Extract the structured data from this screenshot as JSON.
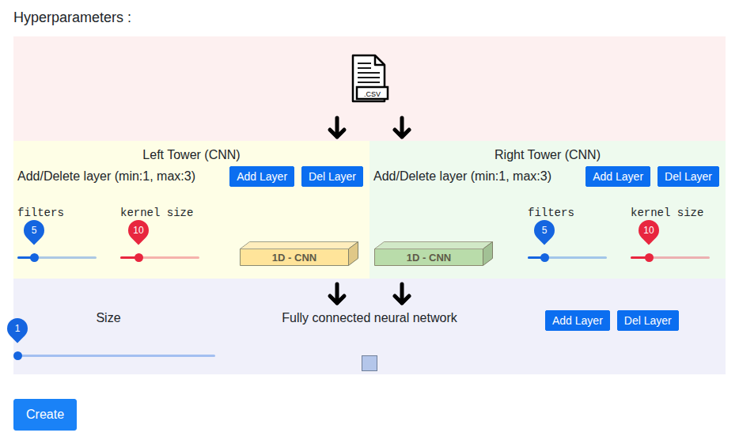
{
  "title": "Hyperparameters :",
  "input": {
    "file_label": ".CSV"
  },
  "towers": [
    {
      "title": "Left Tower (CNN)",
      "layer_hint": "Add/Delete layer (min:1, max:3)",
      "buttons": [
        "Add Layer",
        "Del Layer"
      ],
      "color": "#ffe49a",
      "sliders": [
        {
          "label": "filters",
          "value": "5",
          "level": 0.21,
          "color": "#1565e0"
        },
        {
          "label": "kernel size",
          "value": "10",
          "level": 0.23,
          "color": "#e8263f"
        }
      ],
      "layers": [
        {
          "label": "1D - CNN"
        }
      ]
    },
    {
      "title": "Right Tower (CNN)",
      "layer_hint": "Add/Delete layer (min:1, max:3)",
      "buttons": [
        "Add Layer",
        "Del Layer"
      ],
      "color": "#b9dcaa",
      "sliders": [
        {
          "label": "filters",
          "value": "5",
          "level": 0.21,
          "color": "#1565e0"
        },
        {
          "label": "kernel size",
          "value": "10",
          "level": 0.23,
          "color": "#e8263f"
        }
      ],
      "layers": [
        {
          "label": "1D - CNN"
        }
      ]
    }
  ],
  "dense": {
    "title": "Fully connected neural network",
    "slider": {
      "label": "Size",
      "value": "1",
      "level": 0,
      "color": "#1565e0"
    },
    "buttons": [
      "Add Layer",
      "Del Layer"
    ]
  },
  "create_button": "Create"
}
